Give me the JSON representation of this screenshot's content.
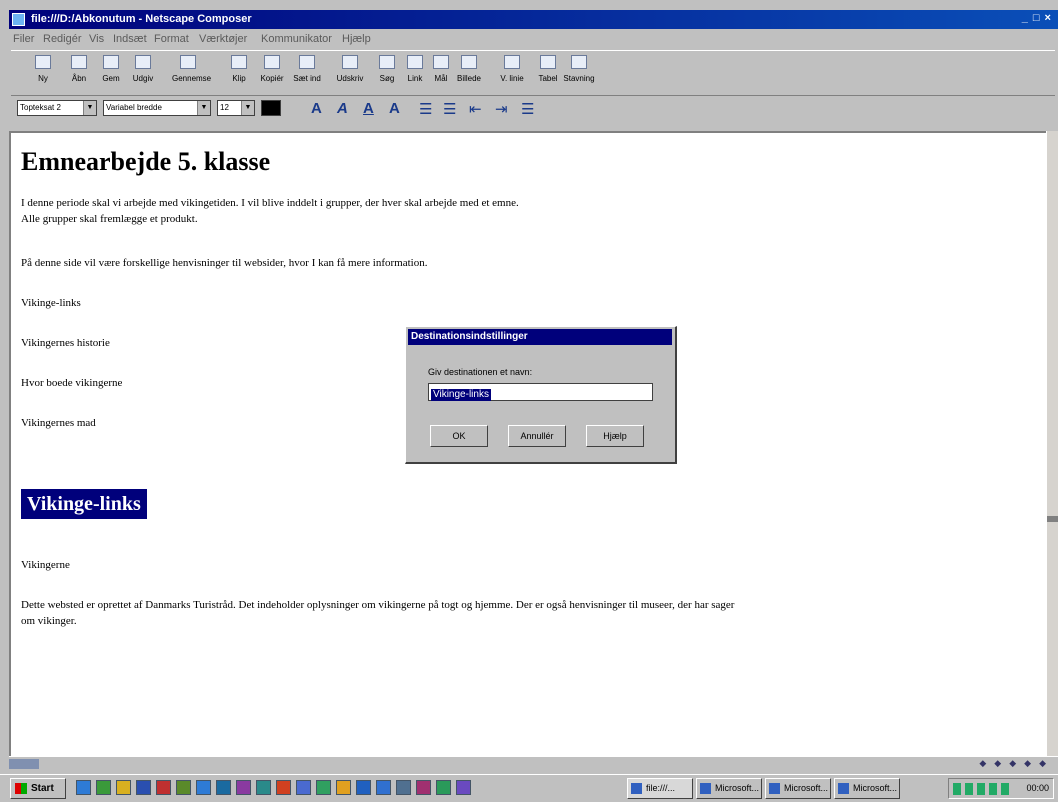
{
  "window": {
    "title": "file:///D:/Abkonutum - Netscape Composer",
    "buttons": "_ □ ×"
  },
  "menu": [
    "Filer",
    "Redigér",
    "Vis",
    "Indsæt",
    "Format",
    "Værktøjer",
    "Kommunikator",
    "Hjælp"
  ],
  "toolbar": {
    "buttons": [
      "Ny",
      "Åbn",
      "Gem",
      "Udgiv",
      "Gennemse",
      "Klip",
      "Kopiér",
      "Sæt ind",
      "Udskriv",
      "Søg",
      "Link",
      "Mål",
      "Billede",
      "V. linie",
      "Tabel",
      "Stavning"
    ]
  },
  "format_bar": {
    "paragraph_style": "Topteksat 2",
    "font": "Variabel bredde",
    "size": "12",
    "format_glyphs": [
      "A",
      "A",
      "A",
      "A",
      "☰",
      "☰",
      "⇤",
      "⇥",
      "☰"
    ]
  },
  "document": {
    "heading": "Emnearbejde 5. klasse",
    "intro_line1": "I denne periode skal vi arbejde med vikingetiden. I vil blive inddelt i grupper, der hver skal arbejde med et emne.",
    "intro_line2": "Alle grupper skal fremlægge et produkt.",
    "links_intro": "På denne side vil være forskellige henvisninger til websider, hvor I kan få mere information.",
    "topics": [
      "Vikinge-links",
      "Vikingernes historie",
      "Hvor boede vikingerne",
      "Vikingernes mad"
    ],
    "anchor_heading": "Vikinge-links",
    "section_title": "Vikingerne",
    "section_text_line1": "Dette websted er oprettet af Danmarks Turistråd. Det indeholder oplysninger om vikingerne på togt og hjemme. Der er også henvisninger til museer, der har sager",
    "section_text_line2": "om vikinger."
  },
  "dialog": {
    "title": "Destinationsindstillinger",
    "label": "Giv destinationen et navn:",
    "value": "Vikinge-links",
    "ok": "OK",
    "cancel": "Annullér",
    "help": "Hjælp"
  },
  "taskbar": {
    "start": "Start",
    "tasks": [
      "file:///...",
      "Microsoft...",
      "Microsoft...",
      "Microsoft..."
    ],
    "clock": "00:00"
  }
}
